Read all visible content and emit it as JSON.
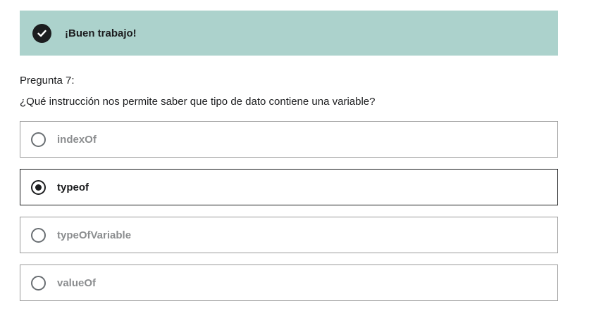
{
  "feedback": {
    "icon": "check-circle-icon",
    "text": "¡Buen trabajo!",
    "background_color": "#acd2cc"
  },
  "question": {
    "number_label": "Pregunta 7:",
    "text": "¿Qué instrucción nos permite saber que tipo de dato contiene una variable?"
  },
  "options": [
    {
      "label": "indexOf",
      "selected": false
    },
    {
      "label": "typeof",
      "selected": true
    },
    {
      "label": "typeOfVariable",
      "selected": false
    },
    {
      "label": "valueOf",
      "selected": false
    }
  ],
  "colors": {
    "text": "#1c1d1f",
    "muted_text": "#8b8d8f",
    "border": "#9a9a9a"
  }
}
